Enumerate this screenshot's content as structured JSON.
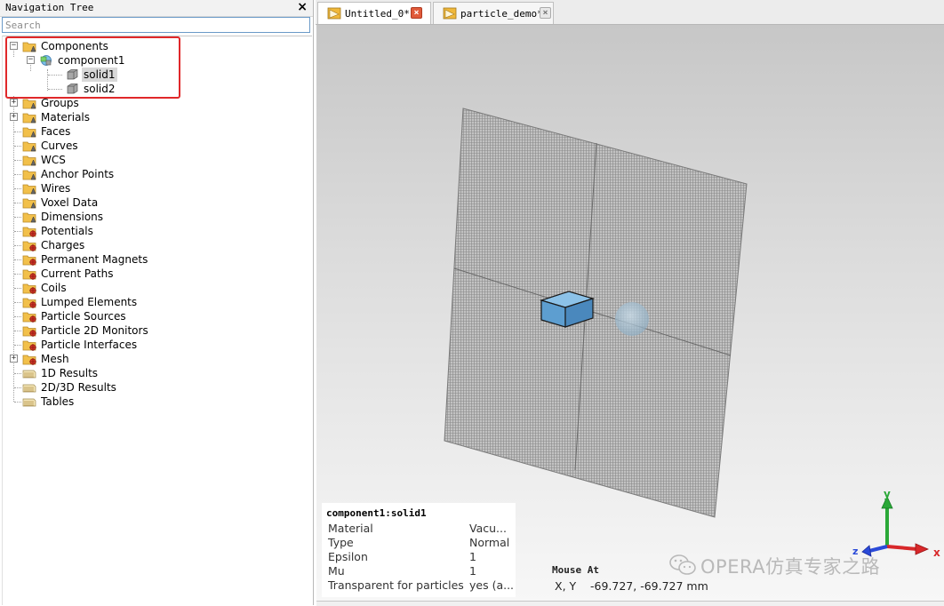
{
  "nav": {
    "title": "Navigation Tree",
    "close_glyph": "×",
    "search_placeholder": "Search",
    "tree": {
      "components": "Components",
      "component1": "component1",
      "solid1": "solid1",
      "solid2": "solid2",
      "items": [
        {
          "label": "Groups",
          "icon": "folder-icon"
        },
        {
          "label": "Materials",
          "icon": "folder-icon"
        },
        {
          "label": "Faces",
          "icon": "folder-icon"
        },
        {
          "label": "Curves",
          "icon": "folder-icon"
        },
        {
          "label": "WCS",
          "icon": "folder-icon"
        },
        {
          "label": "Anchor Points",
          "icon": "folder-icon"
        },
        {
          "label": "Wires",
          "icon": "folder-icon"
        },
        {
          "label": "Voxel Data",
          "icon": "folder-icon"
        },
        {
          "label": "Dimensions",
          "icon": "folder-icon"
        },
        {
          "label": "Potentials",
          "icon": "source-folder-icon"
        },
        {
          "label": "Charges",
          "icon": "source-folder-icon"
        },
        {
          "label": "Permanent Magnets",
          "icon": "source-folder-icon"
        },
        {
          "label": "Current Paths",
          "icon": "source-folder-icon"
        },
        {
          "label": "Coils",
          "icon": "source-folder-icon"
        },
        {
          "label": "Lumped Elements",
          "icon": "source-folder-icon"
        },
        {
          "label": "Particle Sources",
          "icon": "source-folder-icon"
        },
        {
          "label": "Particle 2D Monitors",
          "icon": "source-folder-icon"
        },
        {
          "label": "Particle Interfaces",
          "icon": "source-folder-icon"
        },
        {
          "label": "Mesh",
          "icon": "source-folder-icon"
        },
        {
          "label": "1D Results",
          "icon": "results-icon"
        },
        {
          "label": "2D/3D Results",
          "icon": "results-icon"
        },
        {
          "label": "Tables",
          "icon": "results-icon"
        }
      ]
    }
  },
  "tabs": [
    {
      "label": "Untitled_0*",
      "active": true
    },
    {
      "label": "particle_demo*",
      "active": false
    }
  ],
  "tab_close_glyph": "×",
  "properties": {
    "title": "component1:solid1",
    "rows": [
      {
        "key": "Material",
        "value": "Vacu..."
      },
      {
        "key": "Type",
        "value": "Normal"
      },
      {
        "key": "Epsilon",
        "value": "1"
      },
      {
        "key": "Mu",
        "value": "1"
      },
      {
        "key": "Transparent for particles",
        "value": "yes (a..."
      }
    ]
  },
  "mouse": {
    "title": "Mouse At",
    "axes_label": "X, Y",
    "value": "-69.727,  -69.727 mm"
  },
  "triad": {
    "x": "x",
    "y": "y",
    "z": "z"
  },
  "watermark": "OPERA仿真专家之路",
  "colors": {
    "accent_red": "#e0282a",
    "cube": "#6aa8d8",
    "x_axis": "#d8282a",
    "y_axis": "#2aa838",
    "z_axis": "#2a4ad8"
  }
}
